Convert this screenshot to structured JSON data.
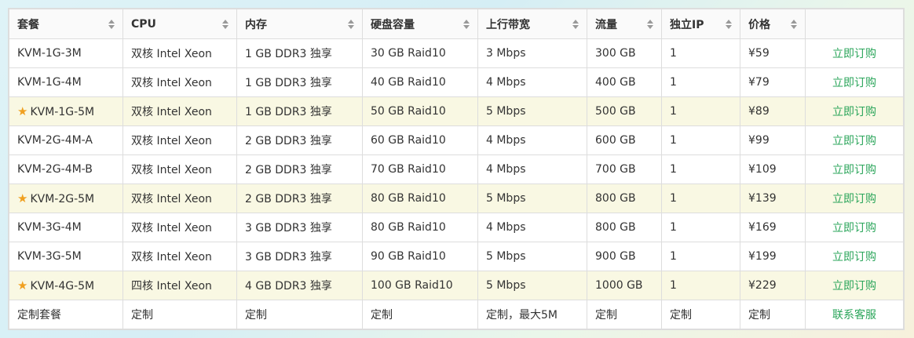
{
  "headers": [
    "套餐",
    "CPU",
    "内存",
    "硬盘容量",
    "上行带宽",
    "流量",
    "独立IP",
    "价格",
    ""
  ],
  "rows": [
    {
      "plan": "KVM-1G-3M",
      "cpu": "双核 Intel Xeon",
      "mem": "1 GB DDR3 独享",
      "disk": "30 GB Raid10",
      "bw": "3 Mbps",
      "traffic": "300 GB",
      "ip": "1",
      "price": "¥59",
      "action": "立即订购",
      "featured": false
    },
    {
      "plan": "KVM-1G-4M",
      "cpu": "双核 Intel Xeon",
      "mem": "1 GB DDR3 独享",
      "disk": "40 GB Raid10",
      "bw": "4 Mbps",
      "traffic": "400 GB",
      "ip": "1",
      "price": "¥79",
      "action": "立即订购",
      "featured": false
    },
    {
      "plan": "KVM-1G-5M",
      "cpu": "双核 Intel Xeon",
      "mem": "1 GB DDR3 独享",
      "disk": "50 GB Raid10",
      "bw": "5 Mbps",
      "traffic": "500 GB",
      "ip": "1",
      "price": "¥89",
      "action": "立即订购",
      "featured": true
    },
    {
      "plan": "KVM-2G-4M-A",
      "cpu": "双核 Intel Xeon",
      "mem": "2 GB DDR3 独享",
      "disk": "60 GB Raid10",
      "bw": "4 Mbps",
      "traffic": "600 GB",
      "ip": "1",
      "price": "¥99",
      "action": "立即订购",
      "featured": false
    },
    {
      "plan": "KVM-2G-4M-B",
      "cpu": "双核 Intel Xeon",
      "mem": "2 GB DDR3 独享",
      "disk": "70 GB Raid10",
      "bw": "4 Mbps",
      "traffic": "700 GB",
      "ip": "1",
      "price": "¥109",
      "action": "立即订购",
      "featured": false
    },
    {
      "plan": "KVM-2G-5M",
      "cpu": "双核 Intel Xeon",
      "mem": "2 GB DDR3 独享",
      "disk": "80 GB Raid10",
      "bw": "5 Mbps",
      "traffic": "800 GB",
      "ip": "1",
      "price": "¥139",
      "action": "立即订购",
      "featured": true
    },
    {
      "plan": "KVM-3G-4M",
      "cpu": "双核 Intel Xeon",
      "mem": "3 GB DDR3 独享",
      "disk": "80 GB Raid10",
      "bw": "4 Mbps",
      "traffic": "800 GB",
      "ip": "1",
      "price": "¥169",
      "action": "立即订购",
      "featured": false
    },
    {
      "plan": "KVM-3G-5M",
      "cpu": "双核 Intel Xeon",
      "mem": "3 GB DDR3 独享",
      "disk": "90 GB Raid10",
      "bw": "5 Mbps",
      "traffic": "900 GB",
      "ip": "1",
      "price": "¥199",
      "action": "立即订购",
      "featured": false
    },
    {
      "plan": "KVM-4G-5M",
      "cpu": "四核 Intel Xeon",
      "mem": "4 GB DDR3 独享",
      "disk": "100 GB Raid10",
      "bw": "5 Mbps",
      "traffic": "1000 GB",
      "ip": "1",
      "price": "¥229",
      "action": "立即订购",
      "featured": true
    },
    {
      "plan": "定制套餐",
      "cpu": "定制",
      "mem": "定制",
      "disk": "定制",
      "bw": "定制，最大5M",
      "traffic": "定制",
      "ip": "定制",
      "price": "定制",
      "action": "联系客服",
      "featured": false
    }
  ],
  "colors": {
    "action": "#2aa55a",
    "star": "#f0a020",
    "featured_row": "#f9f8e3"
  },
  "icons": {
    "featured": "star-icon",
    "sort": "sort-icon"
  }
}
